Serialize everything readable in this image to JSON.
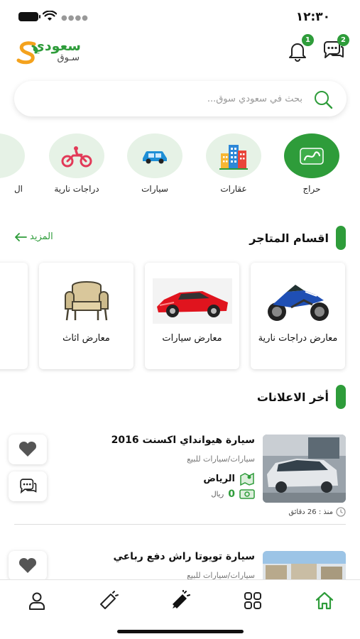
{
  "status": {
    "time": "١٢:٣٠"
  },
  "header": {
    "brand": "سعودي",
    "brand_sub": "سـوق",
    "messages_badge": "2",
    "notifications_badge": "1"
  },
  "search": {
    "placeholder": "بحث في سعودي سوق..."
  },
  "categories": [
    {
      "label": "حراج",
      "icon": "haraj-logo-icon"
    },
    {
      "label": "عقارات",
      "icon": "buildings-icon"
    },
    {
      "label": "سيارات",
      "icon": "car-icon"
    },
    {
      "label": "دراجات نارية",
      "icon": "motorcycle-icon"
    },
    {
      "label": "ال",
      "icon": "partial-icon"
    }
  ],
  "stores_section": {
    "title": "اقسام المتاجر",
    "more_label": "المزيد",
    "items": [
      {
        "label": "معارض دراجات نارية",
        "icon": "sport-motorcycle-image"
      },
      {
        "label": "معارض سيارات",
        "icon": "red-sports-car-image"
      },
      {
        "label": "معارض اثاث",
        "icon": "armchair-image"
      }
    ]
  },
  "ads_section": {
    "title": "أخر الاعلانات",
    "items": [
      {
        "title": "سيارة هيوانداي اكسنت 2016",
        "category": "سيارات/سيارات للبيع",
        "location": "الرياض",
        "price": "0",
        "currency": "ريال",
        "time": "منذ : 26 دقائق"
      },
      {
        "title": "سيارة تويوتا راش دفع رباعي",
        "category": "سيارات/سيارات للبيع"
      }
    ]
  },
  "colors": {
    "accent": "#2e9c3a",
    "category_bg": "#e6f2e6"
  }
}
